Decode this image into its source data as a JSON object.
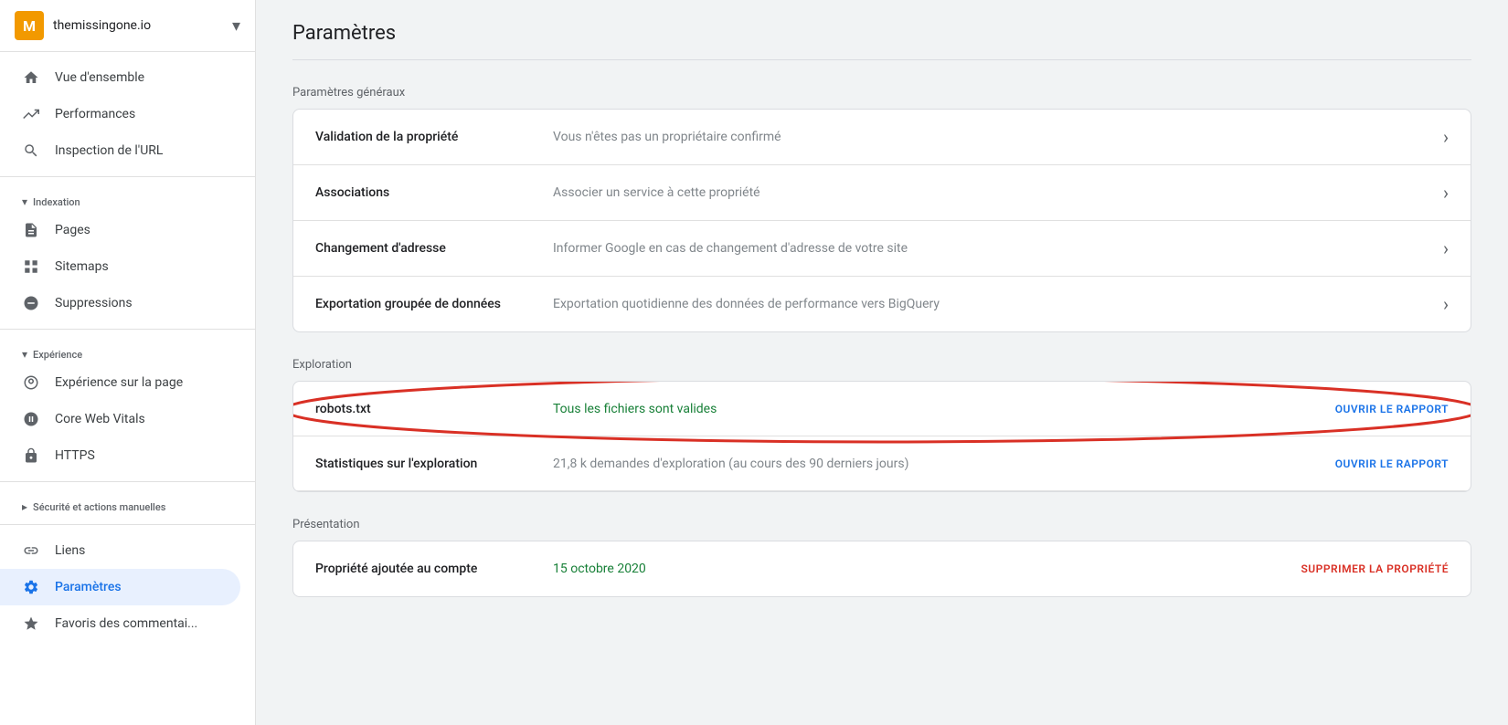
{
  "sidebar": {
    "site_name": "themissingone.io",
    "logo_letter": "M",
    "items": [
      {
        "id": "vue-ensemble",
        "label": "Vue d'ensemble",
        "icon": "home",
        "active": false
      },
      {
        "id": "performances",
        "label": "Performances",
        "icon": "trending-up",
        "active": false
      },
      {
        "id": "inspection-url",
        "label": "Inspection de l'URL",
        "icon": "search",
        "active": false
      },
      {
        "id": "indexation-section",
        "label": "Indexation",
        "type": "section"
      },
      {
        "id": "pages",
        "label": "Pages",
        "icon": "file",
        "active": false
      },
      {
        "id": "sitemaps",
        "label": "Sitemaps",
        "icon": "grid",
        "active": false
      },
      {
        "id": "suppressions",
        "label": "Suppressions",
        "icon": "remove-circle",
        "active": false
      },
      {
        "id": "experience-section",
        "label": "Expérience",
        "type": "section"
      },
      {
        "id": "experience-page",
        "label": "Expérience sur la page",
        "icon": "settings-circle",
        "active": false
      },
      {
        "id": "core-web-vitals",
        "label": "Core Web Vitals",
        "icon": "gauge",
        "active": false
      },
      {
        "id": "https",
        "label": "HTTPS",
        "icon": "lock",
        "active": false
      },
      {
        "id": "securite-section",
        "label": "Sécurité et actions manuelles",
        "type": "section-collapsed"
      },
      {
        "id": "liens",
        "label": "Liens",
        "icon": "link",
        "active": false
      },
      {
        "id": "parametres",
        "label": "Paramètres",
        "icon": "gear",
        "active": true
      },
      {
        "id": "favoris-commentaires",
        "label": "Favoris des commentai...",
        "icon": "star",
        "active": false
      }
    ]
  },
  "page": {
    "title": "Paramètres"
  },
  "parametres_generaux": {
    "section_title": "Paramètres généraux",
    "rows": [
      {
        "label": "Validation de la propriété",
        "value": "Vous n'êtes pas un propriétaire confirmé",
        "has_chevron": true,
        "action": null
      },
      {
        "label": "Associations",
        "value": "Associer un service à cette propriété",
        "has_chevron": true,
        "action": null
      },
      {
        "label": "Changement d'adresse",
        "value": "Informer Google en cas de changement d'adresse de votre site",
        "has_chevron": true,
        "action": null
      },
      {
        "label": "Exportation groupée de données",
        "value": "Exportation quotidienne des données de performance vers BigQuery",
        "has_chevron": true,
        "action": null
      }
    ]
  },
  "exploration": {
    "section_title": "Exploration",
    "rows": [
      {
        "label": "robots.txt",
        "value": "Tous les fichiers sont valides",
        "value_color": "green",
        "action": "OUVRIR LE RAPPORT",
        "has_chevron": false,
        "annotated": true
      },
      {
        "label": "Statistiques sur l'exploration",
        "value": "21,8 k demandes d'exploration (au cours des 90 derniers jours)",
        "value_color": "gray",
        "action": "OUVRIR LE RAPPORT",
        "has_chevron": false,
        "annotated": false
      }
    ]
  },
  "presentation": {
    "section_title": "Présentation",
    "rows": [
      {
        "label": "Propriété ajoutée au compte",
        "value": "15 octobre 2020",
        "value_color": "green",
        "action": "SUPPRIMER LA PROPRIÉTÉ",
        "action_type": "danger",
        "has_chevron": false
      }
    ]
  }
}
